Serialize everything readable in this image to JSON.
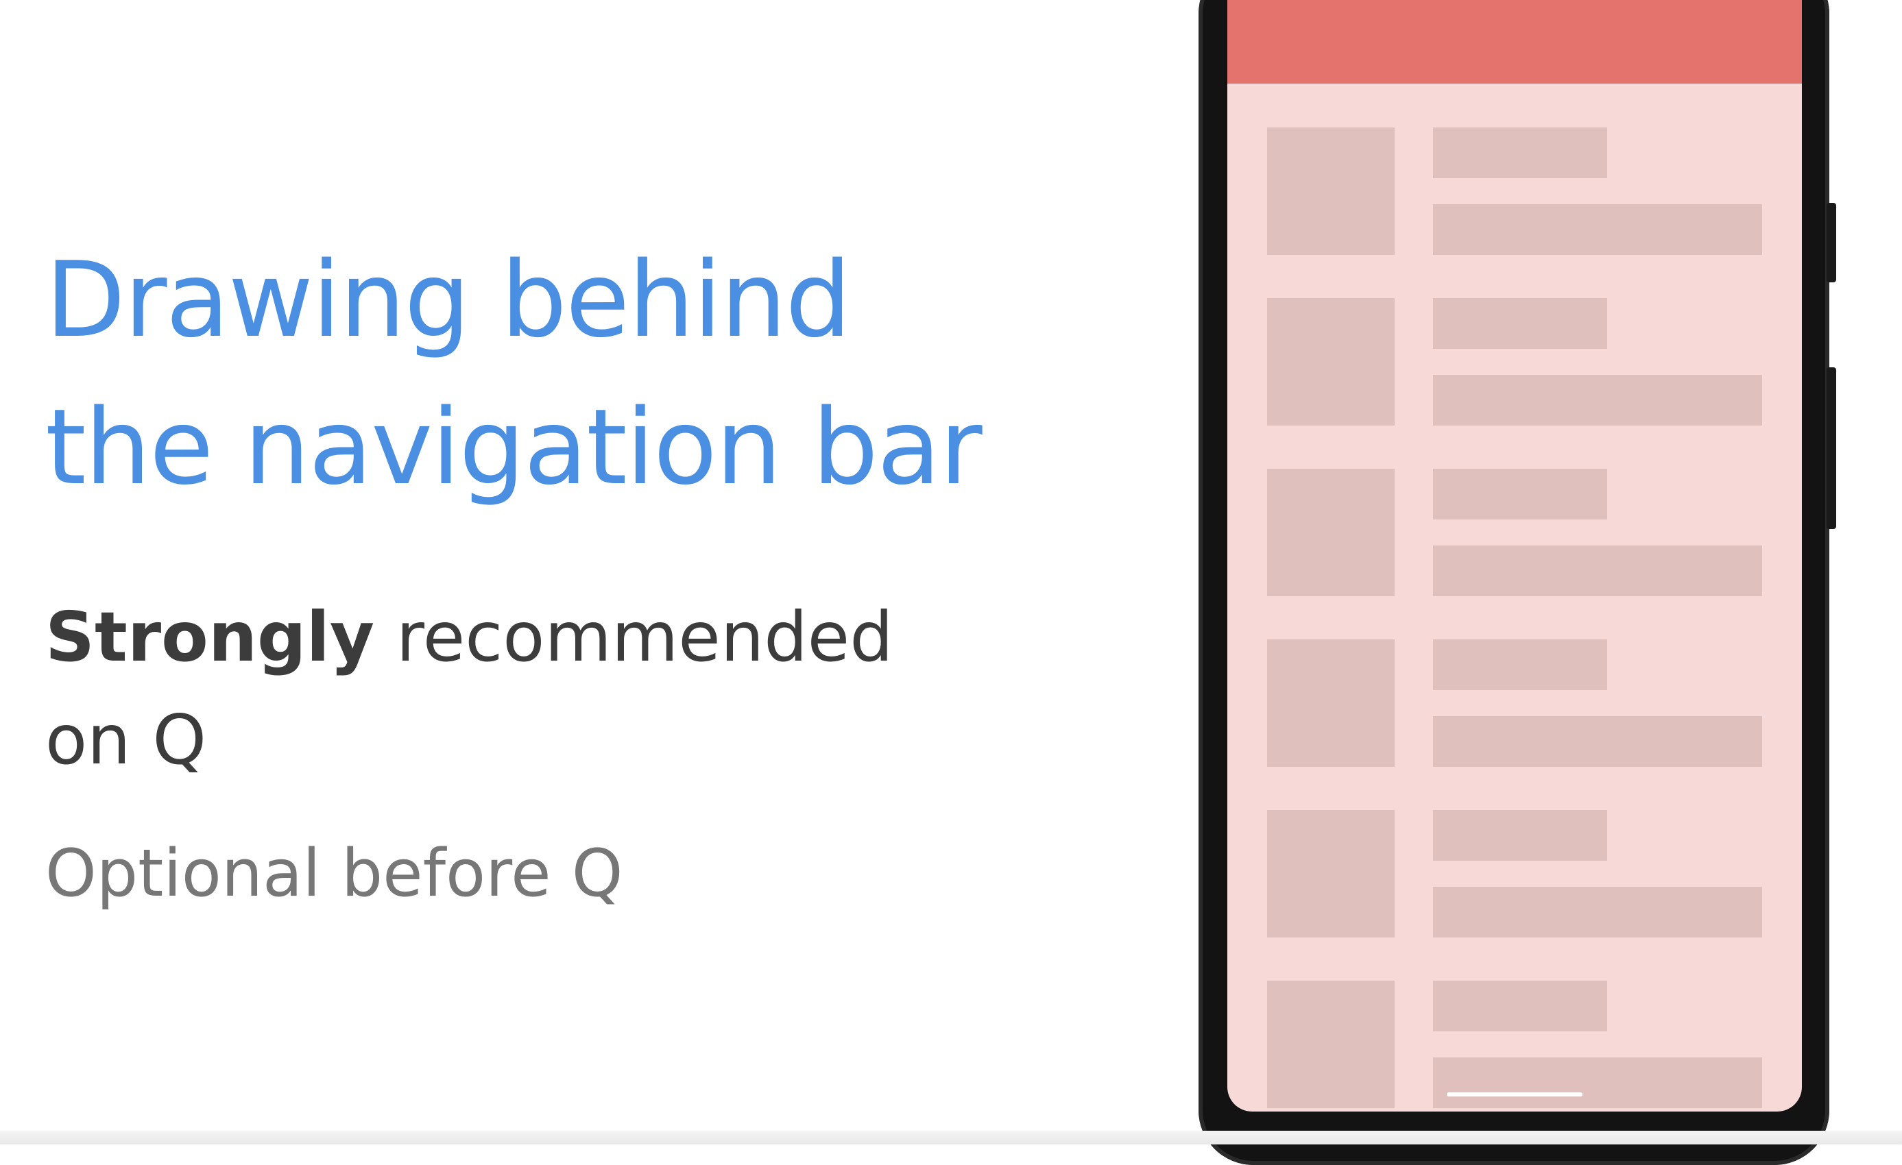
{
  "slide": {
    "title_line1": "Drawing behind",
    "title_line2": "the navigation bar",
    "emphasis_word": "Strongly",
    "recommended_text": " recommended",
    "recommended_suffix": "on Q",
    "optional_text": "Optional before Q"
  },
  "colors": {
    "title": "#4a8fe2",
    "body_text": "#3c3c3c",
    "secondary_text": "#777777",
    "app_bar": "#e5736d",
    "screen_background": "#f7dad7",
    "placeholder": "#dfc0bd"
  },
  "phone": {
    "list_item_count": 6,
    "gesture_handle": "nav-gesture-handle"
  }
}
